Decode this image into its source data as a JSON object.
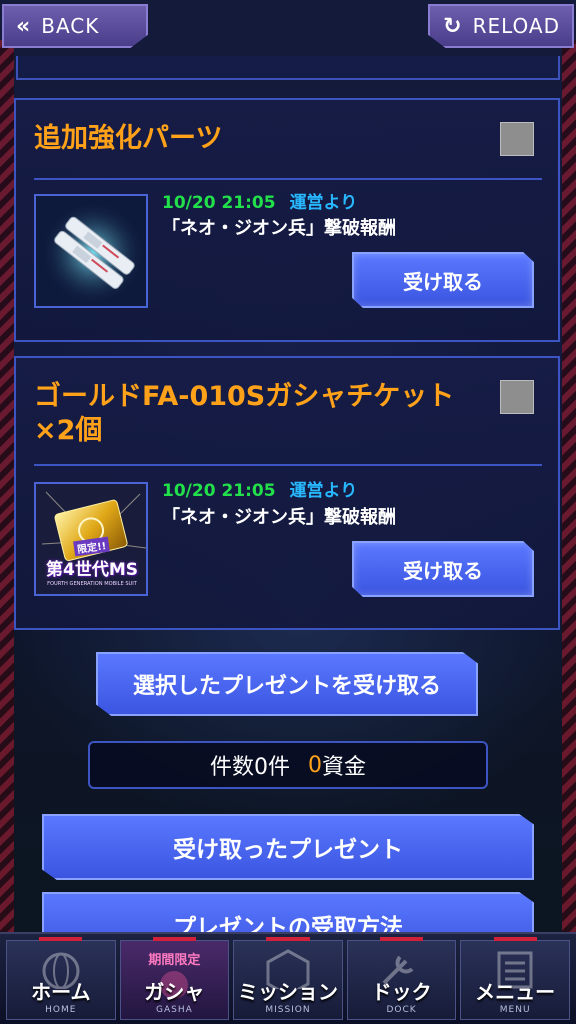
{
  "header": {
    "back_label": "BACK",
    "reload_label": "RELOAD"
  },
  "presents": [
    {
      "title": "追加強化パーツ",
      "date": "10/20 21:05",
      "sender": "運営より",
      "description": "「ネオ・ジオン兵」撃破報酬",
      "receive_label": "受け取る",
      "icon": "parts-icon"
    },
    {
      "title": "ゴールドFA-010Sガシャチケット×2個",
      "date": "10/20 21:05",
      "sender": "運営より",
      "description": "「ネオ・ジオン兵」撃破報酬",
      "receive_label": "受け取る",
      "icon": "ticket-icon",
      "icon_text_top": "限定!!",
      "icon_text_main": "第4世代MS",
      "icon_text_sub": "FOURTH GENERATION MOBILE SUIT"
    }
  ],
  "bulk": {
    "receive_selected_label": "選択したプレゼントを受け取る",
    "count_label": "件数0件",
    "funds_value": "0",
    "funds_label": "資金"
  },
  "links": {
    "received_label": "受け取ったプレゼント",
    "how_to_label": "プレゼントの受取方法"
  },
  "nav": [
    {
      "label": "ホーム",
      "sub": "HOME"
    },
    {
      "label": "ガシャ",
      "sub": "GASHA",
      "badge": "期間限定"
    },
    {
      "label": "ミッション",
      "sub": "MISSION"
    },
    {
      "label": "ドック",
      "sub": "DOCK"
    },
    {
      "label": "メニュー",
      "sub": "MENU"
    }
  ],
  "colors": {
    "title_orange": "#ffa21a",
    "date_green": "#22e04a",
    "sender_blue": "#28b8ff",
    "button_blue": "#3b55e0"
  }
}
